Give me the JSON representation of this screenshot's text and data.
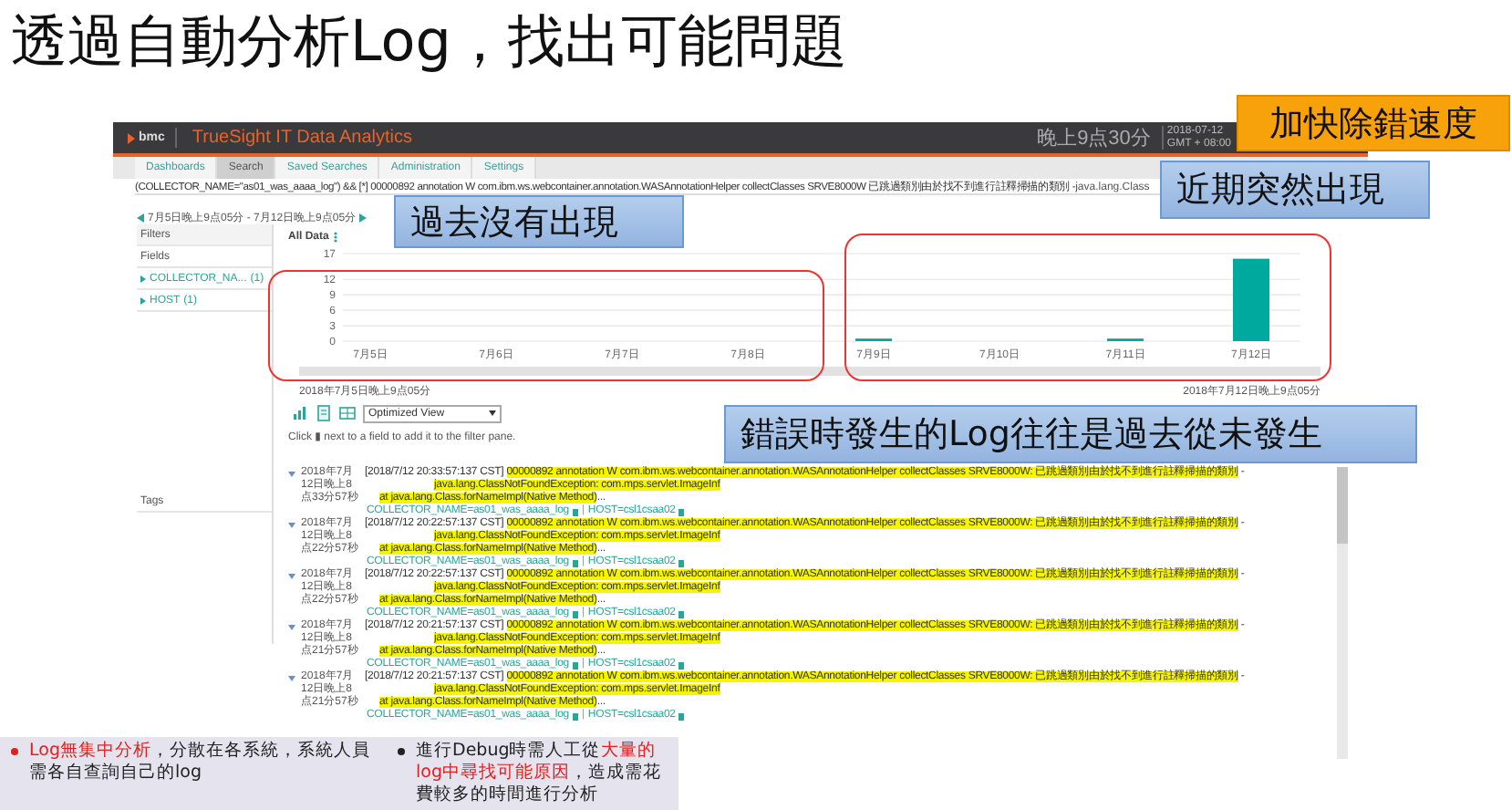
{
  "slide_title": "透過自動分析Log，找出可能問題",
  "app": {
    "brand": "bmc",
    "product": "TrueSight IT Data Analytics",
    "clock": "晚上9点30分",
    "date": "2018-07-12",
    "timezone": "GMT + 08:00",
    "tabs": [
      {
        "label": "Dashboards",
        "selected": false
      },
      {
        "label": "Search",
        "selected": true
      },
      {
        "label": "Saved Searches",
        "selected": false
      },
      {
        "label": "Administration",
        "selected": false
      },
      {
        "label": "Settings",
        "selected": false
      }
    ],
    "query": "(COLLECTOR_NAME=\"as01_was_aaaa_log\") && [*] 00000892 annotation W com.ibm.ws.webcontainer.annotation.WASAnnotationHelper collectClasses SRVE8000W 已跳過類別由於找不到進行註釋掃描的類別 -",
    "query_extra": "java.lang.Class",
    "range": "7月5日晚上9点05分 - 7月12日晚上9点05分",
    "sidebar": {
      "filters": "Filters",
      "fields_label": "Fields",
      "fields": [
        {
          "name": "COLLECTOR_NA...",
          "count": "(1)"
        },
        {
          "name": "HOST",
          "count": "(1)"
        }
      ],
      "tags_label": "Tags"
    },
    "chart_data": {
      "type": "bar",
      "grid": true,
      "categories": [
        "7月5日",
        "7月6日",
        "7月7日",
        "7月8日",
        "7月9日",
        "7月10日",
        "7月11日",
        "7月12日"
      ],
      "series": [
        {
          "name": "All Data",
          "color": "#00a99d",
          "values": [
            0,
            0,
            0,
            0,
            0.5,
            0,
            0.5,
            16
          ]
        }
      ],
      "ylim": [
        0,
        17
      ],
      "yticks": [
        0,
        3,
        6,
        9,
        12,
        17
      ]
    },
    "slider": {
      "level": 1,
      "start": "2018年7月5日晚上9点05分",
      "end": "2018年7月12日晚上9点05分"
    },
    "view_select": "Optimized View",
    "hint": "Click ▮ next to a field to add it to the filter pane.",
    "entries": [
      {
        "timestamp": "2018年7月12日晚上8点33分57秒",
        "header": "[2018/7/12 20:33:57:137 CST]",
        "msg": "00000892 annotation W com.ibm.ws.webcontainer.annotation.WASAnnotationHelper collectClasses SRVE8000W: 已跳過類別由於找不到進行註釋掃描的類別",
        "trail": "-",
        "exception": "java.lang.ClassNotFoundException: com.mps.servlet.ImageInf",
        "stack": "at java.lang.Class.forNameImpl(Native Method)",
        "more": "...",
        "collector": "COLLECTOR_NAME=as01_was_aaaa_log",
        "separator": "|",
        "host": "HOST=csl1csaa02"
      },
      {
        "timestamp": "2018年7月12日晚上8点22分57秒",
        "header": "[2018/7/12 20:22:57:137 CST]",
        "msg": "00000892 annotation W com.ibm.ws.webcontainer.annotation.WASAnnotationHelper collectClasses SRVE8000W: 已跳過類別由於找不到進行註釋掃描的類別",
        "trail": "-",
        "exception": "java.lang.ClassNotFoundException: com.mps.servlet.ImageInf",
        "stack": "at java.lang.Class.forNameImpl(Native Method)",
        "more": "...",
        "collector": "COLLECTOR_NAME=as01_was_aaaa_log",
        "separator": "|",
        "host": "HOST=csl1csaa02"
      },
      {
        "timestamp": "2018年7月12日晚上8点22分57秒",
        "header": "[2018/7/12 20:22:57:137 CST]",
        "msg": "00000892 annotation W com.ibm.ws.webcontainer.annotation.WASAnnotationHelper collectClasses SRVE8000W: 已跳過類別由於找不到進行註釋掃描的類別",
        "trail": "-",
        "exception": "java.lang.ClassNotFoundException: com.mps.servlet.ImageInf",
        "stack": "at java.lang.Class.forNameImpl(Native Method)",
        "more": "...",
        "collector": "COLLECTOR_NAME=as01_was_aaaa_log",
        "separator": "|",
        "host": "HOST=csl1csaa02"
      },
      {
        "timestamp": "2018年7月12日晚上8点21分57秒",
        "header": "[2018/7/12 20:21:57:137 CST]",
        "msg": "00000892 annotation W com.ibm.ws.webcontainer.annotation.WASAnnotationHelper collectClasses SRVE8000W: 已跳過類別由於找不到進行註釋掃描的類別",
        "trail": "-",
        "exception": "java.lang.ClassNotFoundException: com.mps.servlet.ImageInf",
        "stack": "at java.lang.Class.forNameImpl(Native Method)",
        "more": "...",
        "collector": "COLLECTOR_NAME=as01_was_aaaa_log",
        "separator": "|",
        "host": "HOST=csl1csaa02"
      },
      {
        "timestamp": "2018年7月12日晚上8点21分57秒",
        "header": "[2018/7/12 20:21:57:137 CST]",
        "msg": "00000892 annotation W com.ibm.ws.webcontainer.annotation.WASAnnotationHelper collectClasses SRVE8000W: 已跳過類別由於找不到進行註釋掃描的類別",
        "trail": "-",
        "exception": "java.lang.ClassNotFoundException: com.mps.servlet.ImageInf",
        "stack": "at java.lang.Class.forNameImpl(Native Method)",
        "more": "...",
        "collector": "COLLECTOR_NAME=as01_was_aaaa_log",
        "separator": "|",
        "host": "HOST=csl1csaa02"
      }
    ]
  },
  "callouts": [
    {
      "kind": "orange",
      "text": "加快除錯速度"
    },
    {
      "kind": "blue",
      "text": "近期突然出現"
    },
    {
      "kind": "blue",
      "text": "過去沒有出現"
    },
    {
      "kind": "blue",
      "text": "錯誤時發生的Log往往是過去從未發生"
    }
  ],
  "notes": [
    {
      "segments": [
        {
          "text": "Log無集中分析",
          "highlight": true
        },
        {
          "text": "，分散在各系統，系統人員需各自查詢自己的log",
          "highlight": false
        }
      ]
    },
    {
      "segments": [
        {
          "text": "進行Debug時需人工從",
          "highlight": false
        },
        {
          "text": "大量的log中尋找可能原因",
          "highlight": true
        },
        {
          "text": "，造成需花費較多的時間進行分析",
          "highlight": false
        }
      ]
    }
  ]
}
